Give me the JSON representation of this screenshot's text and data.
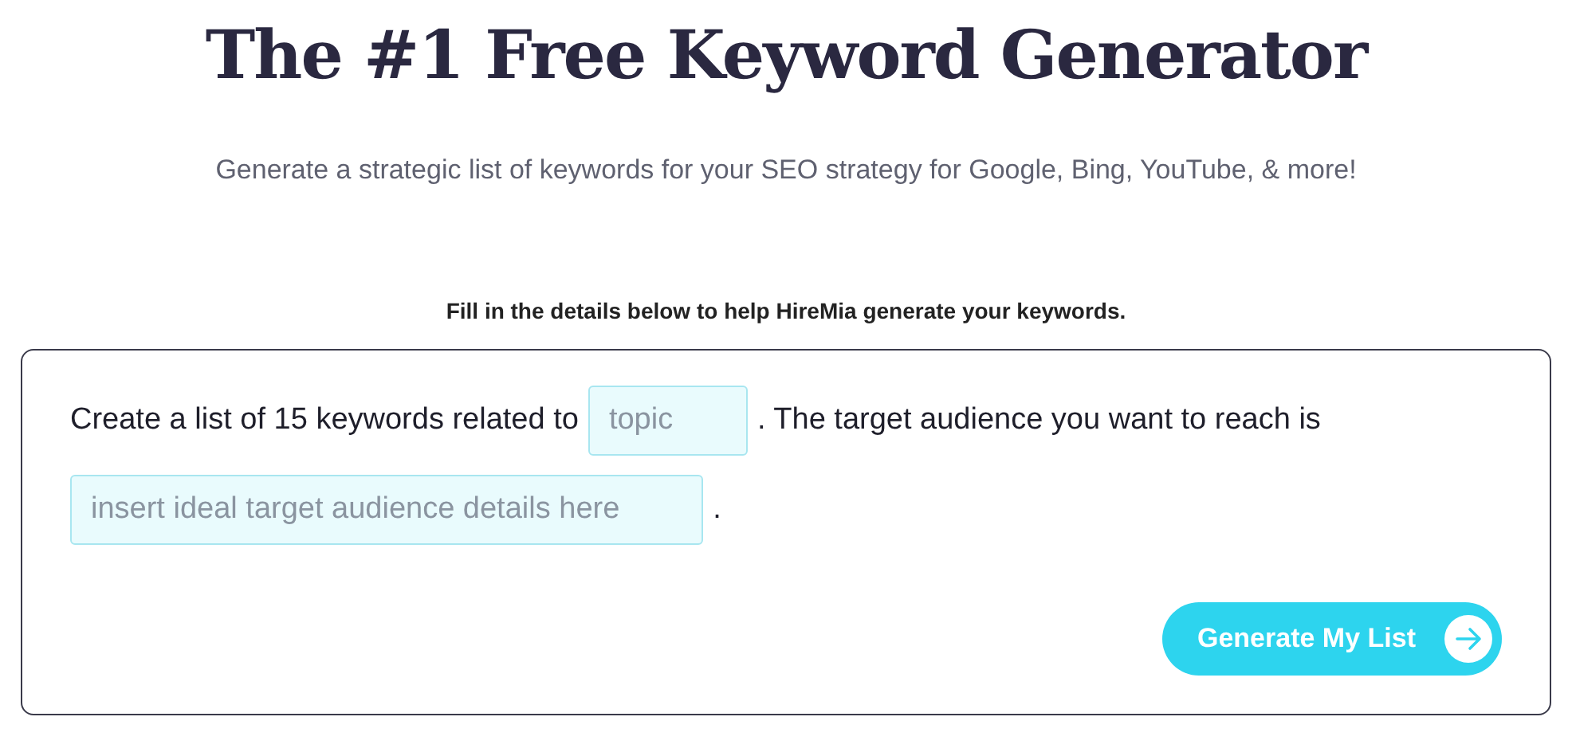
{
  "title": "The #1 Free Keyword Generator",
  "subtitle": "Generate a strategic list of keywords for your SEO strategy for Google, Bing, YouTube, & more!",
  "instruction": "Fill in the details below to help HireMia generate your keywords.",
  "form": {
    "parts": [
      {
        "kind": "text",
        "text": "Create a list of 15 keywords related to"
      },
      {
        "kind": "field",
        "placeholder": "topic"
      },
      {
        "kind": "text",
        "text": ". The target audience you want to reach is"
      },
      {
        "kind": "field",
        "placeholder": "insert ideal target audience details here"
      },
      {
        "kind": "text",
        "text": "."
      }
    ],
    "submit_button": "Generate My List"
  }
}
